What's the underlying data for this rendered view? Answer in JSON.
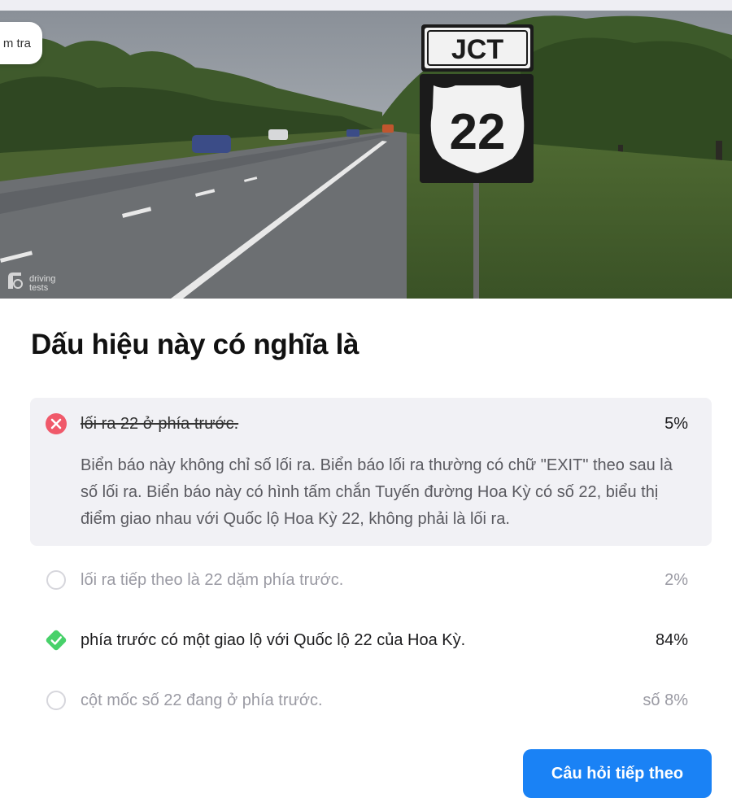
{
  "header": {
    "pill_label": "m tra"
  },
  "image": {
    "watermark_line1": "driving",
    "watermark_line2": "tests",
    "sign_top": "JCT",
    "sign_number": "22"
  },
  "question": {
    "title": "Dấu hiệu này có nghĩa là"
  },
  "answers": [
    {
      "text": "lối ra 22 ở phía trước.",
      "percent": "5%",
      "state": "wrong",
      "explanation": "Biển báo này không chỉ số lối ra. Biển báo lối ra thường có chữ \"EXIT\" theo sau là số lối ra. Biển báo này có hình tấm chắn Tuyến đường Hoa Kỳ có số 22, biểu thị điểm giao nhau với Quốc lộ Hoa Kỳ 22, không phải là lối ra."
    },
    {
      "text": "lối ra tiếp theo là 22 dặm phía trước.",
      "percent": "2%",
      "state": "unselected"
    },
    {
      "text": "phía trước có một giao lộ với Quốc lộ 22 của Hoa Kỳ.",
      "percent": "84%",
      "state": "correct"
    },
    {
      "text": "cột mốc số 22 đang ở phía trước.",
      "percent": "số 8%",
      "state": "unselected"
    }
  ],
  "footer": {
    "next_label": "Câu hỏi tiếp theo"
  },
  "colors": {
    "wrong": "#f0596a",
    "correct": "#48d16a",
    "primary": "#1a82f5",
    "selected_bg": "#f1f1f5"
  },
  "icons": {
    "wrong": "x-circle-icon",
    "correct": "check-diamond-icon",
    "unselected": "radio-empty-icon"
  }
}
